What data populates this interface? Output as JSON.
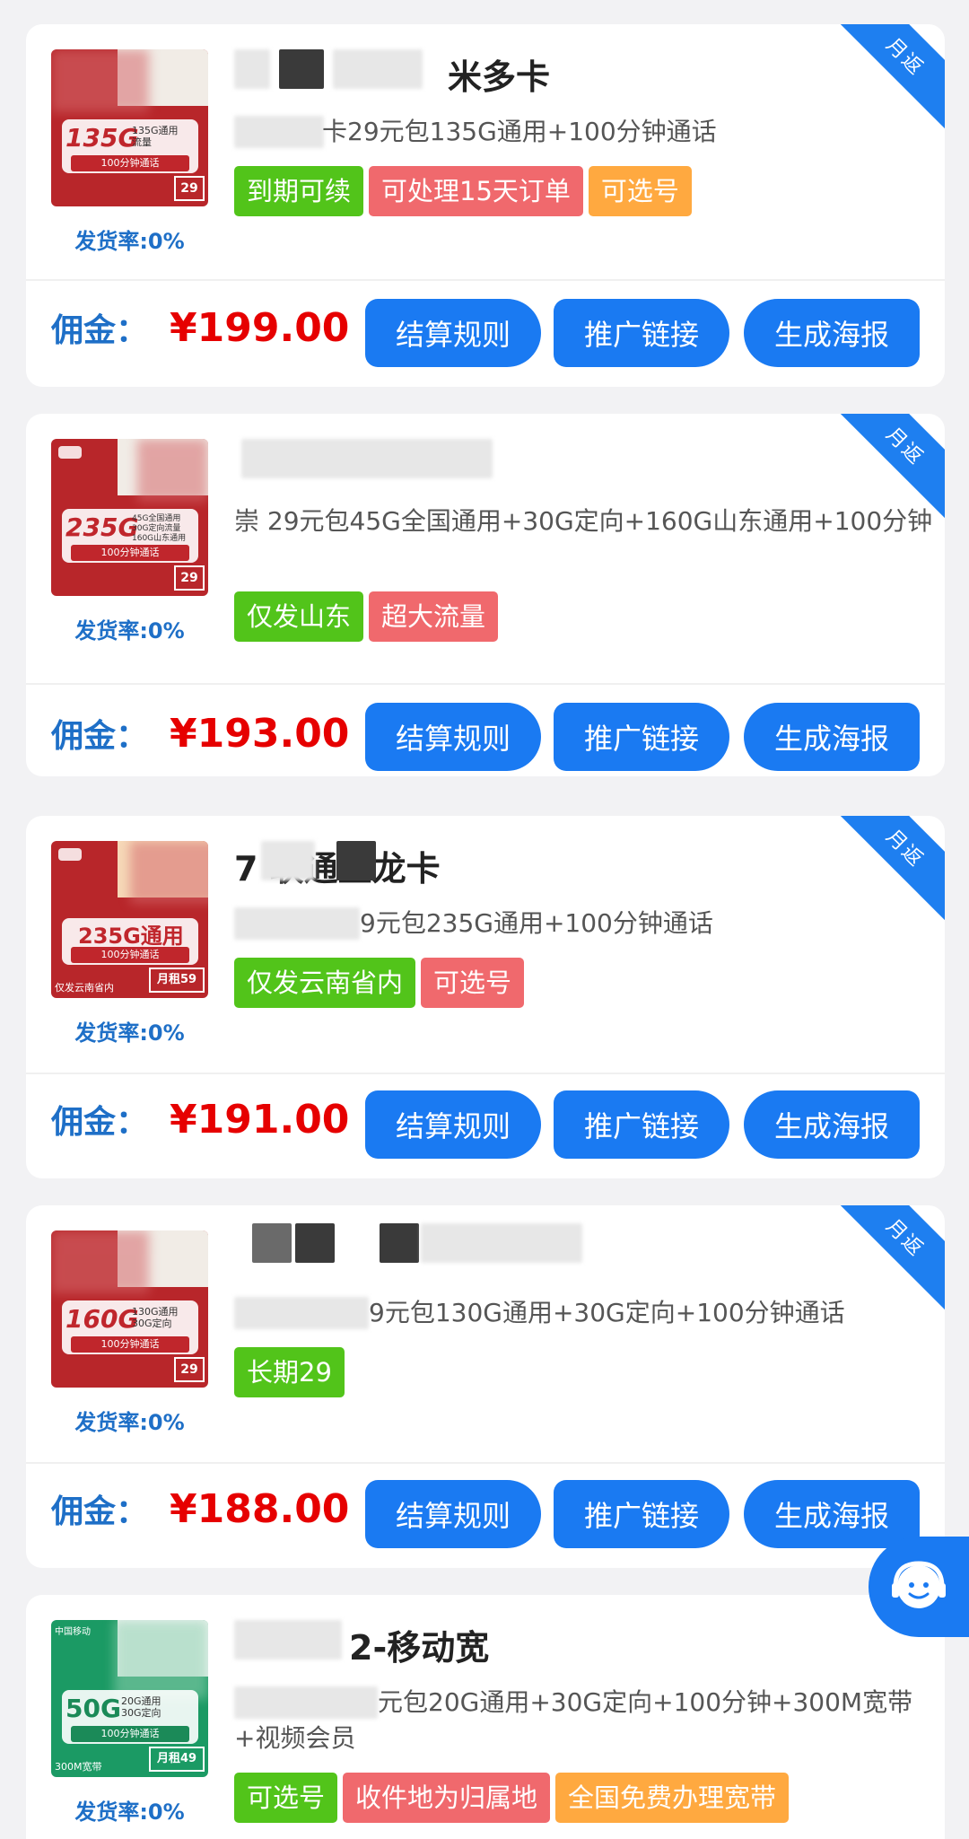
{
  "badge": "月返",
  "ship_label": "发货率:0%",
  "commission_label": "佣金：",
  "buttons": {
    "settlement": "结算规则",
    "promo_link": "推广链接",
    "poster": "生成海报"
  },
  "colors": {
    "primary": "#1a7af2",
    "price": "#e60000",
    "tag_green": "#52c41a",
    "tag_red": "#f0696d",
    "tag_orange": "#ffa940"
  },
  "products": [
    {
      "title": "米多卡",
      "desc": "卡29元包135G通用+100分钟通话",
      "tags": [
        {
          "text": "到期可续",
          "color": "green"
        },
        {
          "text": "可处理15天订单",
          "color": "red"
        },
        {
          "text": "可选号",
          "color": "orange"
        }
      ],
      "commission": "¥199.00",
      "thumb": {
        "big": "135G",
        "small": "135G通用\n流量",
        "minutes": "100分钟通话",
        "price": "29"
      }
    },
    {
      "title": "",
      "desc": "崇    29元包45G全国通用+30G定向+160G山东通用+100分钟",
      "tags": [
        {
          "text": "仅发山东",
          "color": "green"
        },
        {
          "text": "超大流量",
          "color": "red"
        }
      ],
      "commission": "¥193.00",
      "thumb": {
        "big": "235G",
        "small": "45G全国通用\n30G定向流量\n160G山东通用",
        "minutes": "100分钟通话",
        "price": "29"
      }
    },
    {
      "title": "7          联通玉龙卡",
      "desc": "9元包235G通用+100分钟通话",
      "tags": [
        {
          "text": "仅发云南省内",
          "color": "green"
        },
        {
          "text": "可选号",
          "color": "red"
        }
      ],
      "commission": "¥191.00",
      "thumb": {
        "big": "235G通用",
        "small": "",
        "minutes": "100分钟通话",
        "price": "月租59",
        "foot": "仅发云南省内"
      }
    },
    {
      "title": "",
      "desc": "9元包130G通用+30G定向+100分钟通话",
      "tags": [
        {
          "text": "长期29",
          "color": "green"
        }
      ],
      "commission": "¥188.00",
      "thumb": {
        "big": "160G",
        "small": "130G通用\n30G定向",
        "minutes": "100分钟通话",
        "price": "29"
      }
    },
    {
      "title": "2-移动宽",
      "desc": "元包20G通用+30G定向+100分钟+300M宽带+视频会员",
      "tags": [
        {
          "text": "可选号",
          "color": "green"
        },
        {
          "text": "收件地为归属地",
          "color": "red"
        },
        {
          "text": "全国免费办理宽带",
          "color": "orange"
        }
      ],
      "commission": "",
      "thumb": {
        "big": "50G",
        "small": "20G通用\n30G定向",
        "minutes": "100分钟通话",
        "price": "月租49",
        "foot": "300M宽带",
        "brand": "中国移动"
      }
    }
  ]
}
